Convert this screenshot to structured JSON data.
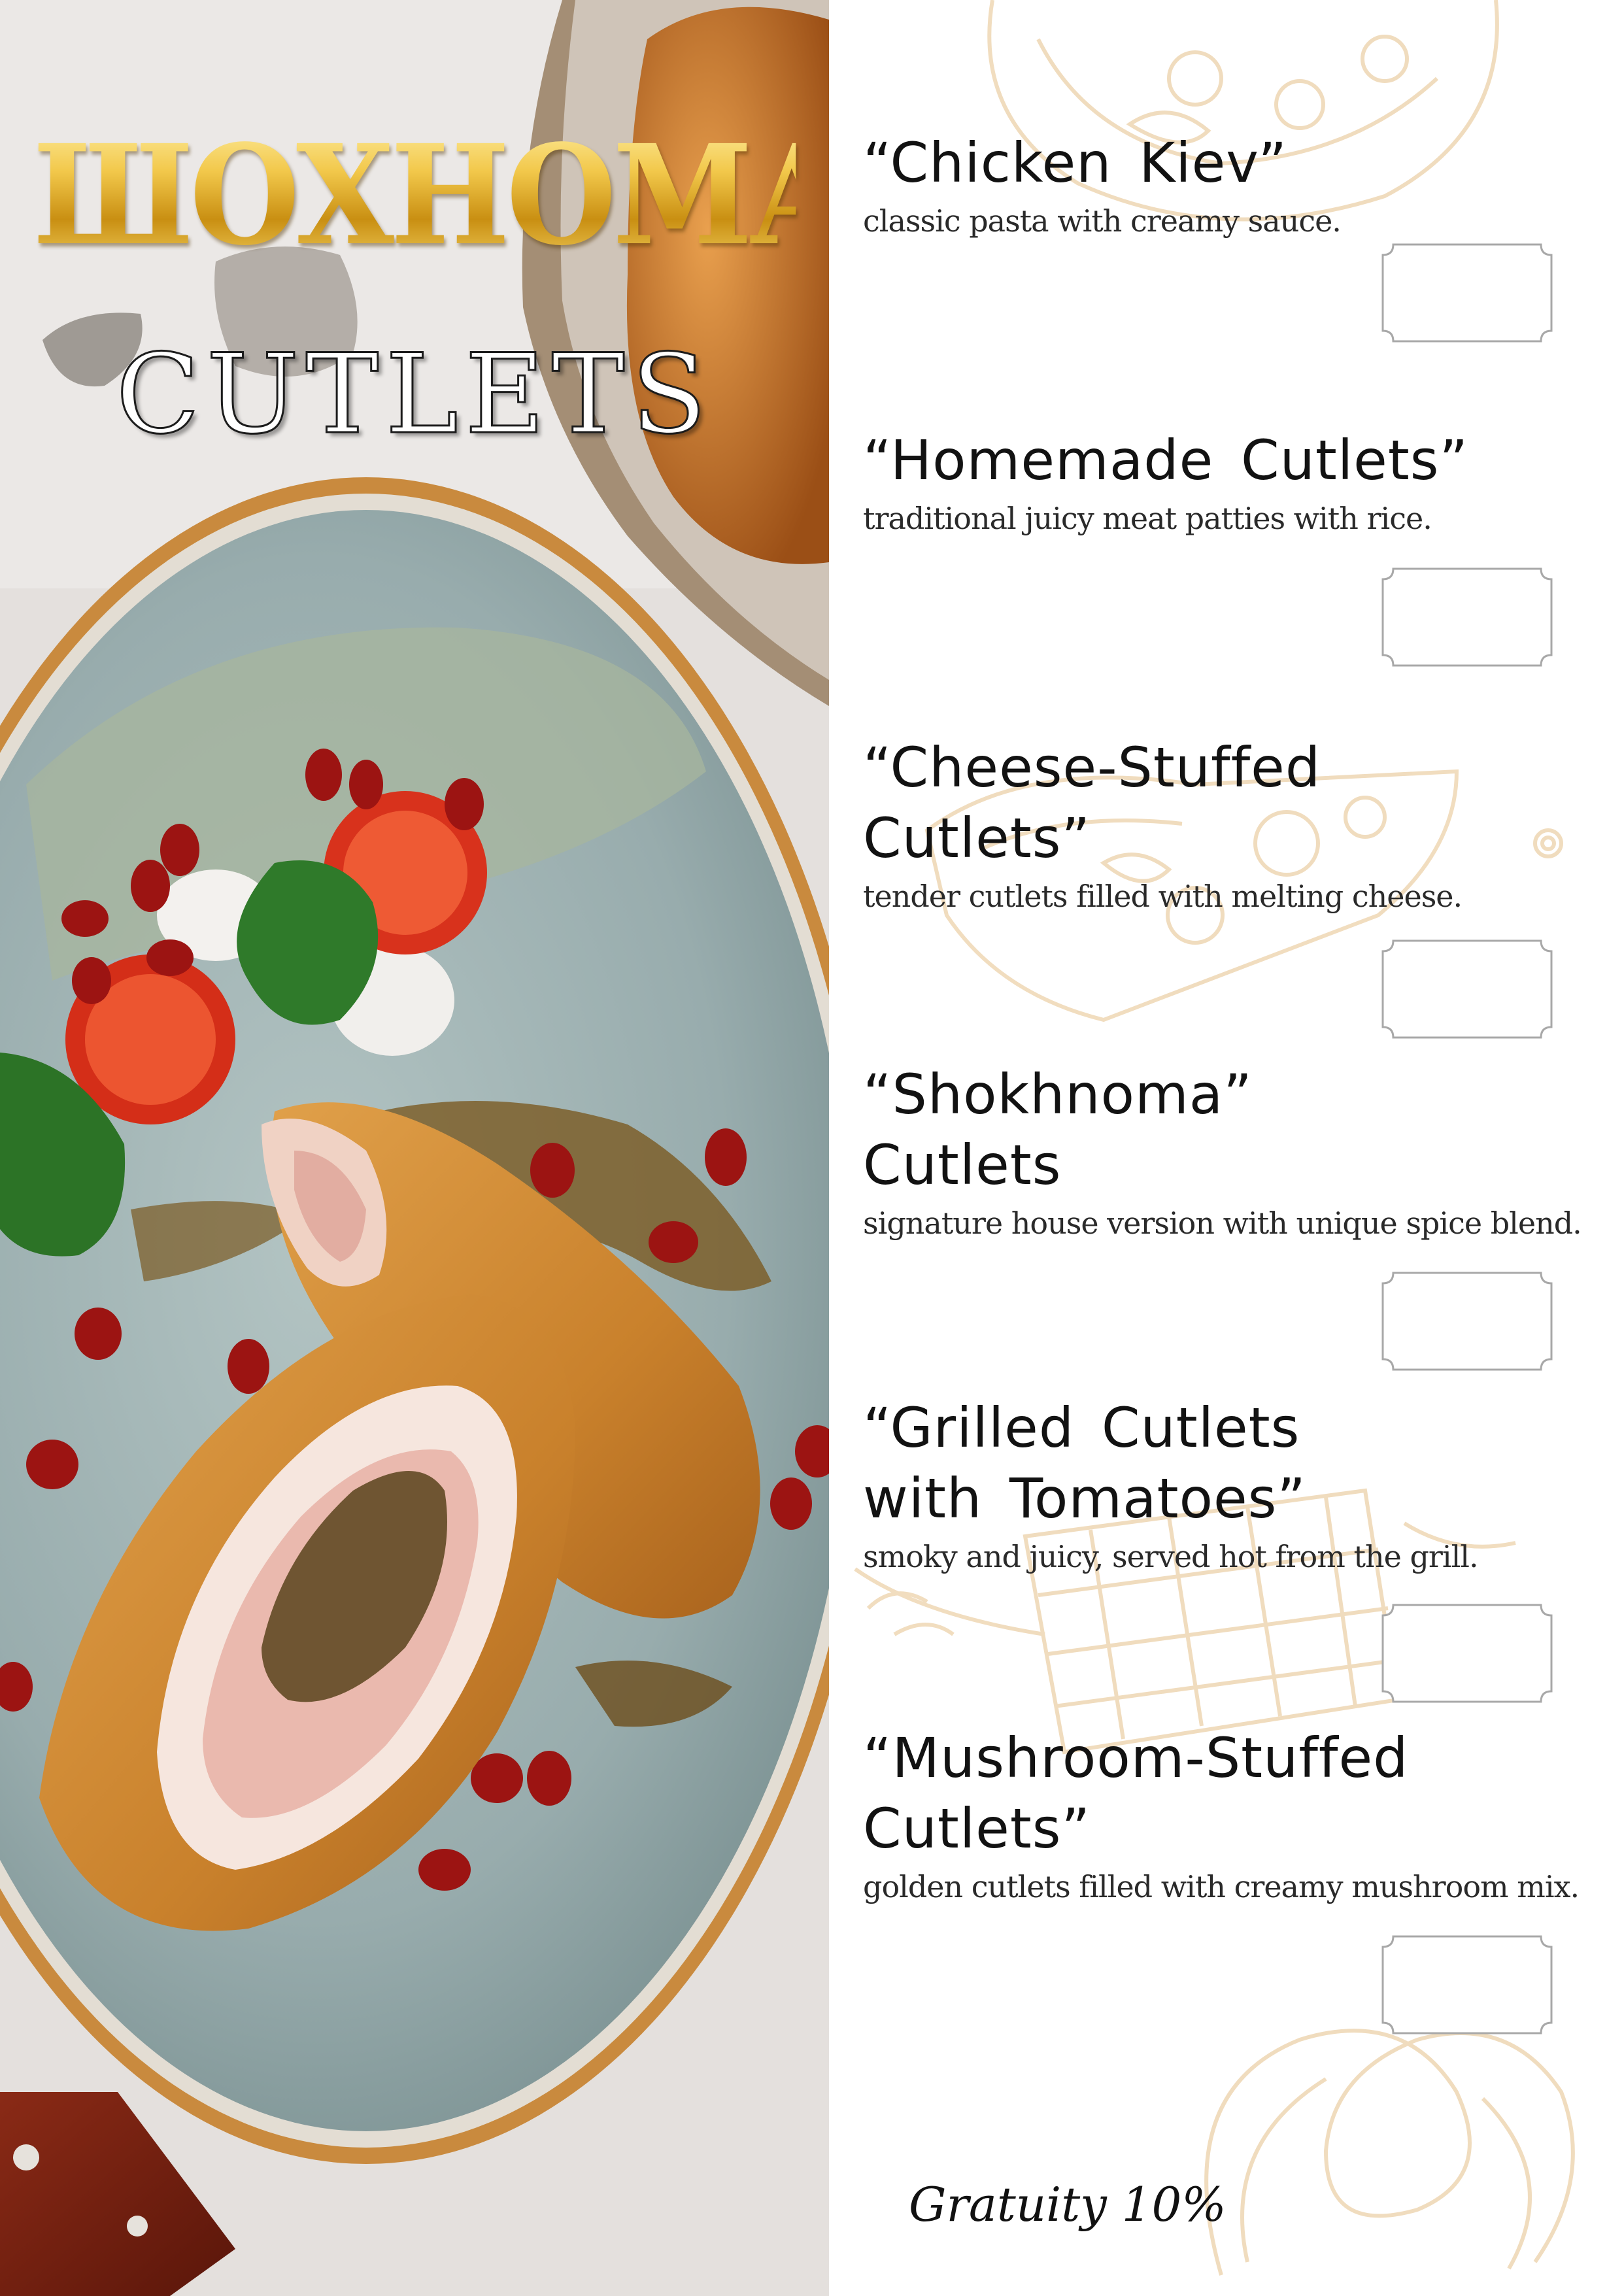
{
  "brand": {
    "name": "ШОХНОМА",
    "subtitle": "CUTLETS"
  },
  "menu": {
    "items": [
      {
        "title": "“Chicken  Kiev”",
        "description": "classic pasta with creamy sauce."
      },
      {
        "title": "“Homemade  Cutlets”",
        "description": "traditional juicy meat patties with rice."
      },
      {
        "title": "“Cheese-Stuffed\nCutlets”",
        "description": "tender cutlets filled with melting cheese."
      },
      {
        "title": "“Shokhnoma”\n  Cutlets",
        "description": "signature house version with unique spice blend."
      },
      {
        "title": "“Grilled  Cutlets\n  with  Tomatoes”",
        "description": "smoky and juicy, served hot from the grill."
      },
      {
        "title": "“Mushroom-Stuffed\n  Cutlets”",
        "description": "golden cutlets filled with creamy mushroom mix."
      }
    ],
    "gratuity": "Gratuity 10%"
  },
  "colors": {
    "gold": "#e3b52a",
    "sketch": "#efd9b8",
    "plate": "#9fb3b4",
    "crust": "#cf8a35"
  }
}
